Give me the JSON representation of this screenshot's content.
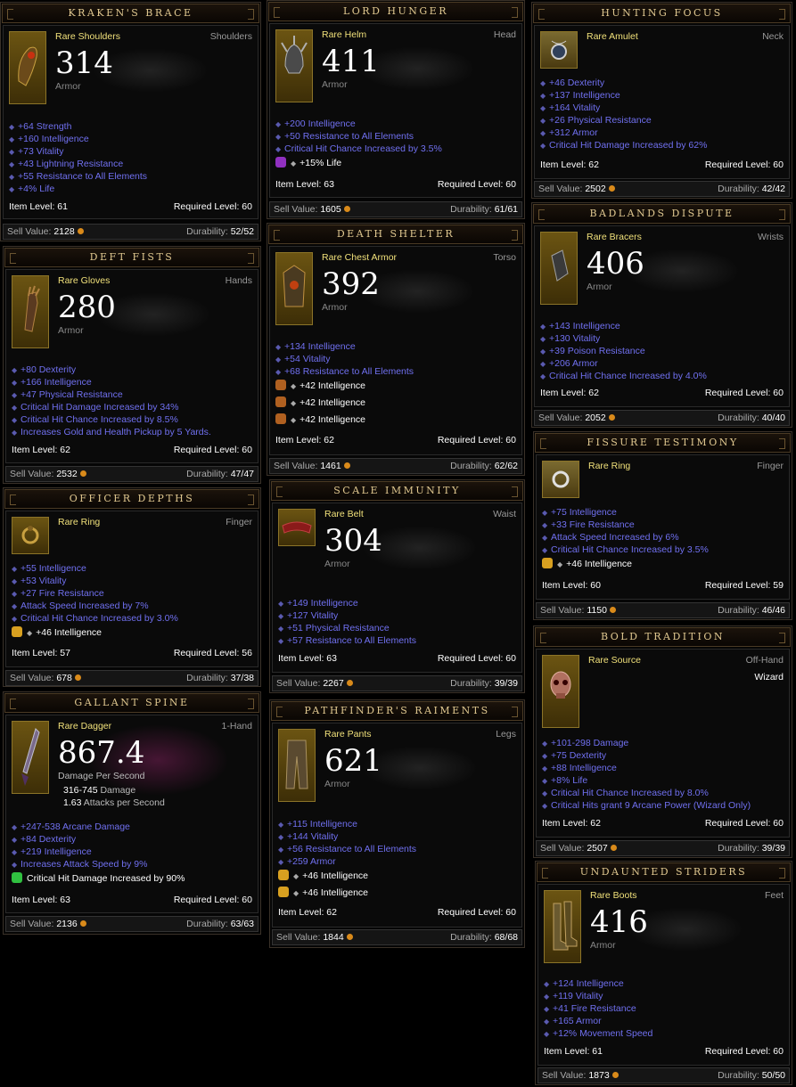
{
  "cards": {
    "kraken": {
      "name": "KRAKEN'S BRACE",
      "type": "Rare Shoulders",
      "slot": "Shoulders",
      "value": "314",
      "value_label": "Armor",
      "stats": [
        "+64 Strength",
        "+160 Intelligence",
        "+73 Vitality",
        "+43 Lightning Resistance",
        "+55 Resistance to All Elements",
        "+4% Life"
      ],
      "item_level": "Item Level: 61",
      "req_level": "Required Level: 60",
      "sell_label": "Sell Value:",
      "sell": "2128",
      "dur_label": "Durability:",
      "dur": "52/52"
    },
    "deft": {
      "name": "DEFT FISTS",
      "type": "Rare Gloves",
      "slot": "Hands",
      "value": "280",
      "value_label": "Armor",
      "stats": [
        "+80 Dexterity",
        "+166 Intelligence",
        "+47 Physical Resistance",
        "Critical Hit Damage Increased by 34%",
        "Critical Hit Chance Increased by 8.5%",
        "Increases Gold and Health Pickup by 5 Yards."
      ],
      "item_level": "Item Level: 62",
      "req_level": "Required Level: 60",
      "sell_label": "Sell Value:",
      "sell": "2532",
      "dur_label": "Durability:",
      "dur": "47/47"
    },
    "officer": {
      "name": "OFFICER DEPTHS",
      "type": "Rare Ring",
      "slot": "Finger",
      "stats": [
        "+55 Intelligence",
        "+53 Vitality",
        "+27 Fire Resistance",
        "Attack Speed Increased by 7%",
        "Critical Hit Chance Increased by 3.0%"
      ],
      "gems": [
        "+46 Intelligence"
      ],
      "item_level": "Item Level: 57",
      "req_level": "Required Level: 56",
      "sell_label": "Sell Value:",
      "sell": "678",
      "dur_label": "Durability:",
      "dur": "37/38"
    },
    "gallant": {
      "name": "GALLANT SPINE",
      "type": "Rare Dagger",
      "slot": "1-Hand",
      "value": "867.4",
      "value_label": "Damage Per Second",
      "damage": "316-745",
      "damage_label": "Damage",
      "aps": "1.63",
      "aps_label": "Attacks per Second",
      "stats": [
        "+247-538 Arcane Damage",
        "+84 Dexterity",
        "+219 Intelligence",
        "Increases Attack Speed by 9%"
      ],
      "gems": [
        "Critical Hit Damage Increased by 90%"
      ],
      "item_level": "Item Level: 63",
      "req_level": "Required Level: 60",
      "sell_label": "Sell Value:",
      "sell": "2136",
      "dur_label": "Durability:",
      "dur": "63/63"
    },
    "lord": {
      "name": "LORD HUNGER",
      "type": "Rare Helm",
      "slot": "Head",
      "value": "411",
      "value_label": "Armor",
      "stats": [
        "+200 Intelligence",
        "+50 Resistance to All Elements",
        "Critical Hit Chance Increased by 3.5%"
      ],
      "gems": [
        "+15% Life"
      ],
      "item_level": "Item Level: 63",
      "req_level": "Required Level: 60",
      "sell_label": "Sell Value:",
      "sell": "1605",
      "dur_label": "Durability:",
      "dur": "61/61"
    },
    "death": {
      "name": "DEATH SHELTER",
      "type": "Rare Chest Armor",
      "slot": "Torso",
      "value": "392",
      "value_label": "Armor",
      "stats": [
        "+134 Intelligence",
        "+54 Vitality",
        "+68 Resistance to All Elements"
      ],
      "gems": [
        "+42 Intelligence",
        "+42 Intelligence",
        "+42 Intelligence"
      ],
      "item_level": "Item Level: 62",
      "req_level": "Required Level: 60",
      "sell_label": "Sell Value:",
      "sell": "1461",
      "dur_label": "Durability:",
      "dur": "62/62"
    },
    "scale": {
      "name": "SCALE IMMUNITY",
      "type": "Rare Belt",
      "slot": "Waist",
      "value": "304",
      "value_label": "Armor",
      "stats": [
        "+149 Intelligence",
        "+127 Vitality",
        "+51 Physical Resistance",
        "+57 Resistance to All Elements"
      ],
      "item_level": "Item Level: 63",
      "req_level": "Required Level: 60",
      "sell_label": "Sell Value:",
      "sell": "2267",
      "dur_label": "Durability:",
      "dur": "39/39"
    },
    "path": {
      "name": "PATHFINDER'S RAIMENTS",
      "type": "Rare Pants",
      "slot": "Legs",
      "value": "621",
      "value_label": "Armor",
      "stats": [
        "+115 Intelligence",
        "+144 Vitality",
        "+56 Resistance to All Elements",
        "+259 Armor"
      ],
      "gems": [
        "+46 Intelligence",
        "+46 Intelligence"
      ],
      "item_level": "Item Level: 62",
      "req_level": "Required Level: 60",
      "sell_label": "Sell Value:",
      "sell": "1844",
      "dur_label": "Durability:",
      "dur": "68/68"
    },
    "hunting": {
      "name": "HUNTING FOCUS",
      "type": "Rare Amulet",
      "slot": "Neck",
      "stats": [
        "+46 Dexterity",
        "+137 Intelligence",
        "+164 Vitality",
        "+26 Physical Resistance",
        "+312 Armor",
        "Critical Hit Damage Increased by 62%"
      ],
      "item_level": "Item Level: 62",
      "req_level": "Required Level: 60",
      "sell_label": "Sell Value:",
      "sell": "2502",
      "dur_label": "Durability:",
      "dur": "42/42"
    },
    "badlands": {
      "name": "BADLANDS DISPUTE",
      "type": "Rare Bracers",
      "slot": "Wrists",
      "value": "406",
      "value_label": "Armor",
      "stats": [
        "+143 Intelligence",
        "+130 Vitality",
        "+39 Poison Resistance",
        "+206 Armor",
        "Critical Hit Chance Increased by 4.0%"
      ],
      "item_level": "Item Level: 62",
      "req_level": "Required Level: 60",
      "sell_label": "Sell Value:",
      "sell": "2052",
      "dur_label": "Durability:",
      "dur": "40/40"
    },
    "fissure": {
      "name": "FISSURE TESTIMONY",
      "type": "Rare Ring",
      "slot": "Finger",
      "stats": [
        "+75 Intelligence",
        "+33 Fire Resistance",
        "Attack Speed Increased by 6%",
        "Critical Hit Chance Increased by 3.5%"
      ],
      "gems": [
        "+46 Intelligence"
      ],
      "item_level": "Item Level: 60",
      "req_level": "Required Level: 59",
      "sell_label": "Sell Value:",
      "sell": "1150",
      "dur_label": "Durability:",
      "dur": "46/46"
    },
    "bold": {
      "name": "BOLD TRADITION",
      "type": "Rare Source",
      "slot": "Off-Hand",
      "class_req": "Wizard",
      "stats": [
        "+101-298 Damage",
        "+75 Dexterity",
        "+88 Intelligence",
        "+8% Life",
        "Critical Hit Chance Increased by 8.0%",
        "Critical Hits grant 9 Arcane Power (Wizard Only)"
      ],
      "item_level": "Item Level: 62",
      "req_level": "Required Level: 60",
      "sell_label": "Sell Value:",
      "sell": "2507",
      "dur_label": "Durability:",
      "dur": "39/39"
    },
    "undaunted": {
      "name": "UNDAUNTED STRIDERS",
      "type": "Rare Boots",
      "slot": "Feet",
      "value": "416",
      "value_label": "Armor",
      "stats": [
        "+124 Intelligence",
        "+119 Vitality",
        "+41 Fire Resistance",
        "+165 Armor",
        "+12% Movement Speed"
      ],
      "item_level": "Item Level: 61",
      "req_level": "Required Level: 60",
      "sell_label": "Sell Value:",
      "sell": "1873",
      "dur_label": "Durability:",
      "dur": "50/50"
    }
  },
  "colors": {
    "title": "#e0c890",
    "item_type": "#f0e07a",
    "affix": "#7070f0",
    "coin": "#d98a1a"
  }
}
